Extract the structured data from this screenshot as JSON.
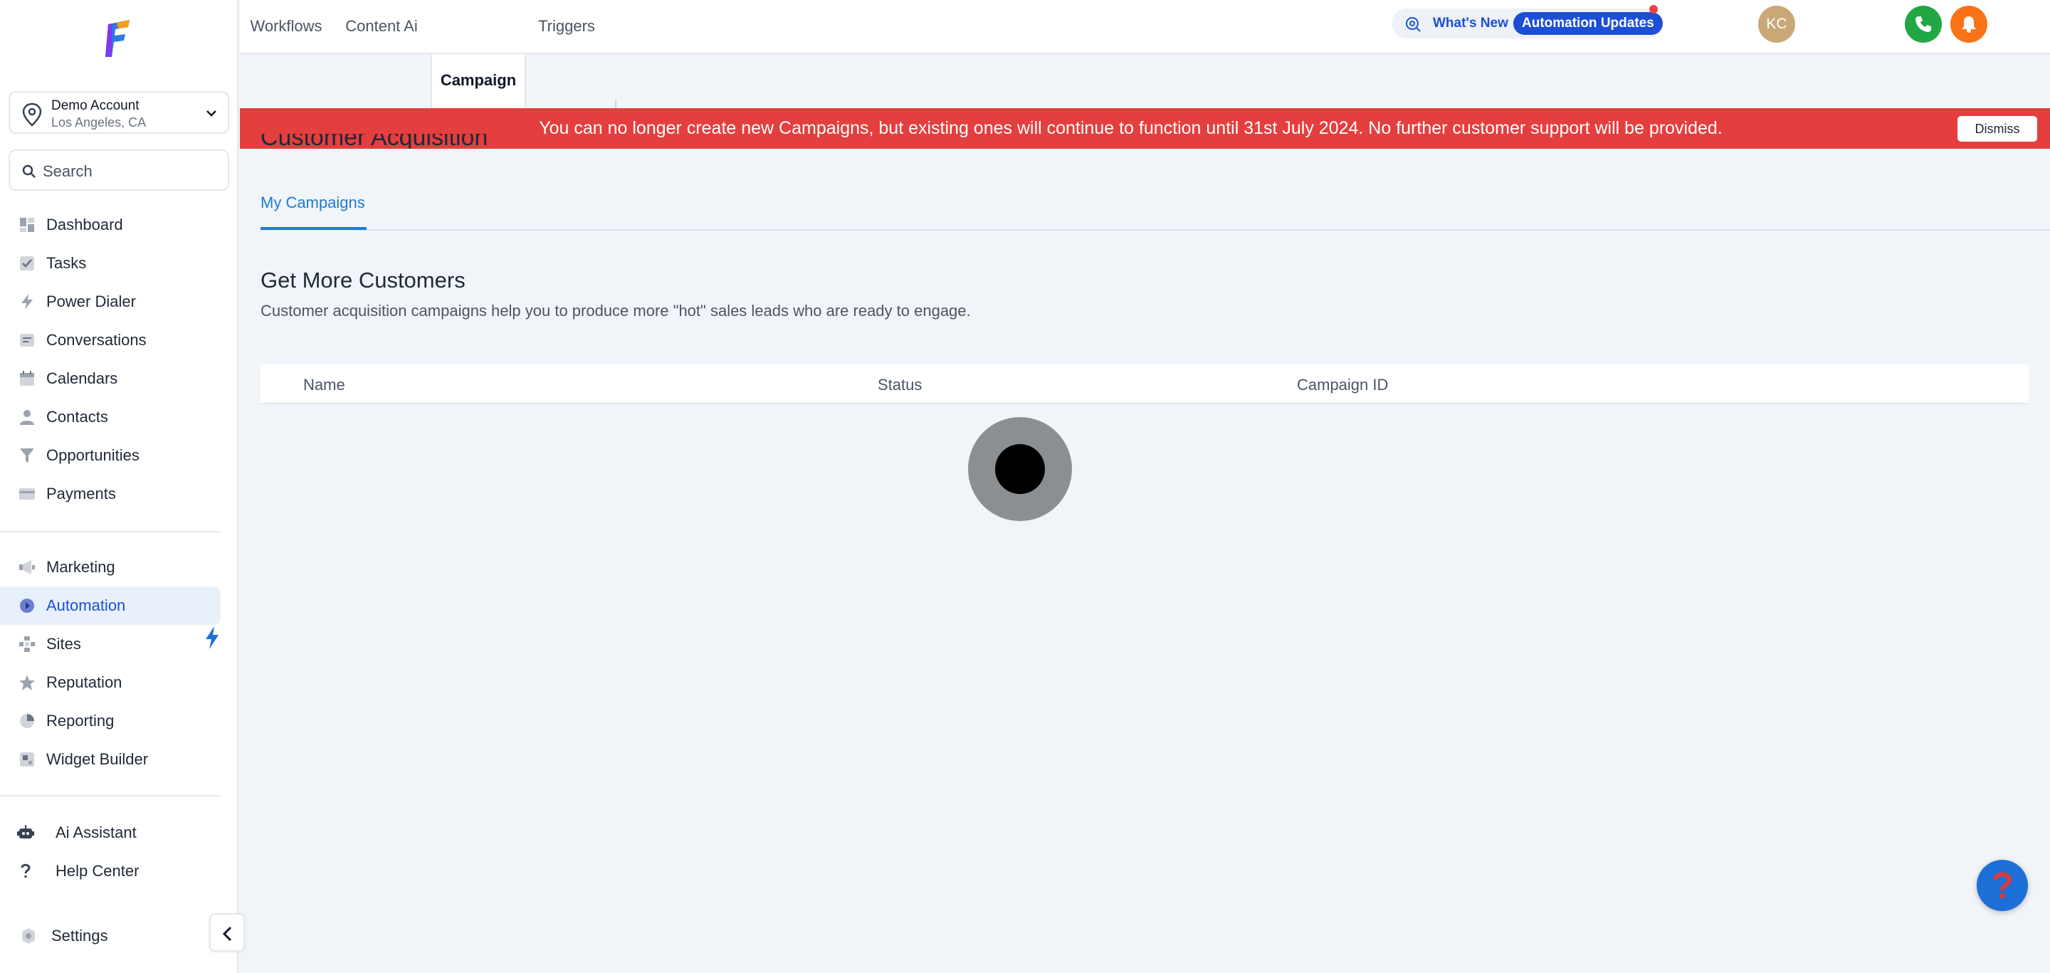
{
  "account": {
    "name": "Demo Account",
    "location": "Los Angeles, CA"
  },
  "search": {
    "placeholder": "Search"
  },
  "nav_primary": [
    {
      "label": "Dashboard",
      "icon": "dashboard-icon"
    },
    {
      "label": "Tasks",
      "icon": "tasks-icon"
    },
    {
      "label": "Power Dialer",
      "icon": "power-dialer-icon"
    },
    {
      "label": "Conversations",
      "icon": "conversations-icon"
    },
    {
      "label": "Calendars",
      "icon": "calendar-icon"
    },
    {
      "label": "Contacts",
      "icon": "contacts-icon"
    },
    {
      "label": "Opportunities",
      "icon": "funnel-icon"
    },
    {
      "label": "Payments",
      "icon": "payments-icon"
    }
  ],
  "nav_secondary": [
    {
      "label": "Marketing",
      "icon": "megaphone-icon"
    },
    {
      "label": "Automation",
      "icon": "automation-icon",
      "active": true
    },
    {
      "label": "Sites",
      "icon": "sites-icon"
    },
    {
      "label": "Reputation",
      "icon": "star-icon"
    },
    {
      "label": "Reporting",
      "icon": "pie-chart-icon"
    },
    {
      "label": "Widget Builder",
      "icon": "widget-icon"
    }
  ],
  "nav_footer": [
    {
      "label": "Ai Assistant",
      "icon": "robot-icon"
    },
    {
      "label": "Help Center",
      "icon": "question-icon"
    }
  ],
  "settings_label": "Settings",
  "topbar": {
    "whats_new": "What's New",
    "automation_updates": "Automation Updates",
    "avatar_initials": "KC"
  },
  "tabs": [
    "Workflows",
    "Content Ai",
    "Campaign",
    "Triggers"
  ],
  "active_tab": "Campaign",
  "banner": {
    "message": "You can no longer create new Campaigns, but existing ones will continue to function until 31st July 2024. No further customer support will be provided.",
    "dismiss": "Dismiss"
  },
  "page": {
    "heading": "Customer Acquisition",
    "subtab": "My Campaigns",
    "section_title": "Get More Customers",
    "section_desc": "Customer acquisition campaigns help you to produce more \"hot\" sales leads who are ready to engage."
  },
  "table": {
    "columns": [
      "Name",
      "Status",
      "Campaign ID"
    ]
  },
  "colors": {
    "accent": "#1d4ed8",
    "banner": "#e53e3e",
    "phone": "#22a745",
    "bell": "#f97316"
  }
}
